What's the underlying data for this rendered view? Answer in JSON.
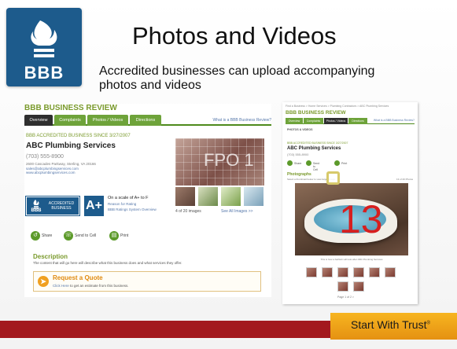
{
  "slide": {
    "logo_text": "BBB",
    "title": "Photos and Videos",
    "subtitle": "Accredited businesses can upload accompanying photos and videos",
    "footer_tagline": "Start With Trust",
    "footer_trademark": "®"
  },
  "left_panel": {
    "section_title": "BBB BUSINESS REVIEW",
    "tabs": [
      {
        "label": "Overview",
        "active": true
      },
      {
        "label": "Complaints",
        "active": false
      },
      {
        "label": "Photos / Videos",
        "active": false
      },
      {
        "label": "Directions",
        "active": false
      }
    ],
    "what_is_link": "What is a BBB Business Review?",
    "accredited_since": "BBB ACCREDITED BUSINESS SINCE 3/27/2007",
    "business_name": "ABC Plumbing Services",
    "phone": "(703) 555-8900",
    "address": "2600 Cascades Parkway, Sterling, VA 20166",
    "email": "sales@abcplumbingservices.com",
    "website": "www.abcplumbingservices.com",
    "seal_text": "ACCREDITED BUSINESS",
    "seal_logo": "BBB",
    "rating": "A+",
    "rating_scale": "On a scale of A+ to F",
    "rating_reason": "Reason for Rating",
    "rating_overview": "BBB Ratings System Overview",
    "photo_placeholder": "FPO 1",
    "image_count": "4 of 20 images",
    "see_all": "See All Images >>",
    "actions": [
      "Share",
      "Send to Cell",
      "Print"
    ],
    "description_heading": "Description",
    "description_text": "The content that will go here will describe what this business does and what services they offer.",
    "quote_heading": "Request a Quote",
    "quote_link": "Click Here",
    "quote_text": " to get an estimate from this business."
  },
  "right_panel": {
    "breadcrumb": "Find a Business > Home Services > Plumbing Contractors > ABC Plumbing Services",
    "section_title": "BBB BUSINESS REVIEW",
    "tabs": [
      {
        "label": "Overview",
        "active": false
      },
      {
        "label": "Complaints",
        "active": false
      },
      {
        "label": "Photos / Videos",
        "active": true
      },
      {
        "label": "Directions",
        "active": false
      }
    ],
    "what_is_link": "What is a BBB Business Review?",
    "subnav": "PHOTOS & VIDEOS",
    "accredited_since": "BBB ACCREDITED BUSINESS SINCE 3/27/2007",
    "business_name": "ABC Plumbing Services",
    "phone": "(703) 555-8900",
    "actions": [
      "Share",
      "Send to Cell",
      "Print"
    ],
    "photos_heading": "Photographs",
    "photos_sub": "Select a thumbnail below to view larger image.",
    "photo_count": "13 of 20 Photos",
    "main_photo_number": "13",
    "caption": "This is how a bathtub will look after ABC Plumbing Services",
    "pager": "Page 1 of 2 >"
  },
  "colors": {
    "bbb_blue": "#1d5b8c",
    "accent_green": "#7a9a2c",
    "footer_red": "#a3191e",
    "footer_gold": "#f7b520"
  }
}
